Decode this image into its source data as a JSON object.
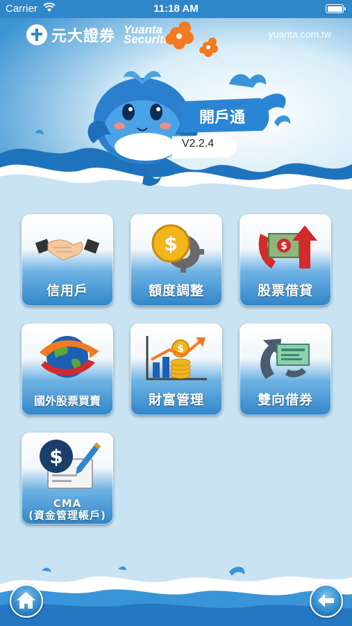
{
  "status_bar": {
    "carrier": "Carrier",
    "time": "11:18 AM"
  },
  "header": {
    "brand_zh": "元大證券",
    "brand_en_line1": "Yuanta",
    "brand_en_line2": "Securities",
    "site": "yuanta.com.tw",
    "app_title": "開戶通",
    "version": "V2.2.4"
  },
  "menu": [
    {
      "label": "信用戶",
      "icon": "handshake-icon"
    },
    {
      "label": "額度調整",
      "icon": "coin-gear-icon"
    },
    {
      "label": "股票借貸",
      "icon": "money-arrow-icon"
    },
    {
      "label": "國外股票買賣",
      "icon": "globe-arrow-icon"
    },
    {
      "label": "財富管理",
      "icon": "coins-chart-icon"
    },
    {
      "label": "雙向借券",
      "icon": "two-way-arrow-icon"
    },
    {
      "label_line1": "CMA",
      "label_line2": "(資金管理帳戶)",
      "icon": "dollar-pen-icon"
    }
  ],
  "footer": {
    "home_icon": "home-icon",
    "back_icon": "back-arrow-icon"
  },
  "colors": {
    "primary": "#2f86c9",
    "background": "#c9e3f3",
    "accent_orange": "#f47a20"
  }
}
